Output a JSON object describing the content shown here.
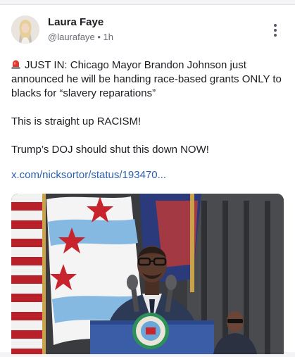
{
  "post": {
    "author_name": "Laura Faye",
    "handle": "@laurafaye",
    "separator": "•",
    "time": "1h",
    "lines": [
      "JUST IN: Chicago Mayor Brandon Johnson just announced he will be handing race-based grants ONLY to blacks for “slavery reparations”",
      "This is straight up RACISM!",
      "Trump’s DOJ should shut this down NOW!"
    ],
    "link_text": "x.com/nicksortor/status/193470...",
    "media_alt_text": "Man in a suit and glasses speaking at a podium with microphones and a city seal, flags behind him"
  },
  "icons": {
    "siren": "rotating-light-emoji",
    "more": "more-vertical-icon",
    "avatar": "profile-photo"
  },
  "colors": {
    "link": "#2a5fb0",
    "text": "#1c1c22",
    "muted": "#6a6a74"
  }
}
